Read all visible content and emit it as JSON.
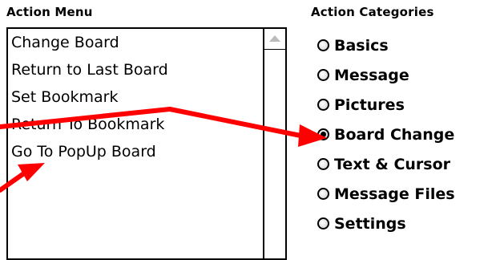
{
  "action_menu": {
    "title": "Action Menu",
    "items": [
      "Change Board",
      "Return to Last Board",
      "Set Bookmark",
      "Return To Bookmark",
      "Go To PopUp Board"
    ]
  },
  "action_categories": {
    "title": "Action Categories",
    "selected": "Board Change",
    "items": [
      "Basics",
      "Message",
      "Pictures",
      "Board Change",
      "Text & Cursor",
      "Message Files",
      "Settings"
    ]
  },
  "colors": {
    "annotation_arrow": "#ff0000"
  }
}
